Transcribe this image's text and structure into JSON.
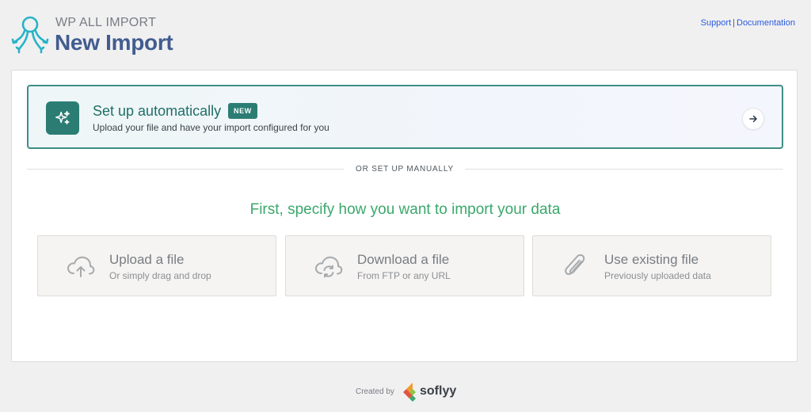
{
  "header": {
    "brand": "WP ALL IMPORT",
    "title": "New Import",
    "support_link": "Support",
    "separator": "|",
    "documentation_link": "Documentation"
  },
  "auto_setup": {
    "title": "Set up automatically",
    "badge": "NEW",
    "description": "Upload your file and have your import configured for you"
  },
  "divider": {
    "text": "OR SET UP MANUALLY"
  },
  "manual": {
    "heading": "First, specify how you want to import your data",
    "options": [
      {
        "title": "Upload a file",
        "subtitle": "Or simply drag and drop",
        "icon": "cloud-upload-icon"
      },
      {
        "title": "Download a file",
        "subtitle": "From FTP or any URL",
        "icon": "cloud-sync-icon"
      },
      {
        "title": "Use existing file",
        "subtitle": "Previously uploaded data",
        "icon": "paperclip-icon"
      }
    ]
  },
  "footer": {
    "created_by": "Created by",
    "company": "soflyy"
  },
  "colors": {
    "teal": "#2b7d74",
    "title_blue": "#425c8f",
    "green_heading": "#3aa86b",
    "link_blue": "#2a5adf"
  }
}
